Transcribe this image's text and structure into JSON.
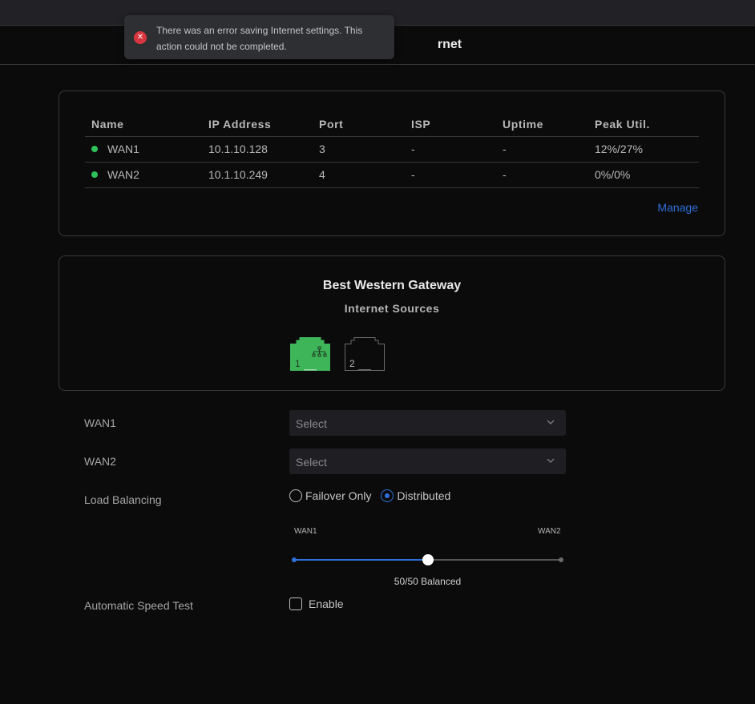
{
  "header": {
    "title_visible": "rnet"
  },
  "toast": {
    "icon": "error-x-icon",
    "message": "There was an error saving Internet settings. This action could not be completed."
  },
  "wan_table": {
    "columns": [
      "Name",
      "IP Address",
      "Port",
      "ISP",
      "Uptime",
      "Peak Util."
    ],
    "rows": [
      {
        "name": "WAN1",
        "status": "online",
        "ip": "10.1.10.128",
        "port": "3",
        "isp": "-",
        "uptime": "-",
        "peak_util": "12%/27%"
      },
      {
        "name": "WAN2",
        "status": "online",
        "ip": "10.1.10.249",
        "port": "4",
        "isp": "-",
        "uptime": "-",
        "peak_util": "0%/0%"
      }
    ],
    "manage_label": "Manage"
  },
  "gateway": {
    "title": "Best Western Gateway",
    "subtitle": "Internet Sources",
    "ports": [
      {
        "number": "1",
        "state": "connected",
        "icon": "network-topology-icon"
      },
      {
        "number": "2",
        "state": "disconnected"
      }
    ]
  },
  "form": {
    "wan1": {
      "label": "WAN1",
      "value": "Select"
    },
    "wan2": {
      "label": "WAN2",
      "value": "Select"
    },
    "load_balancing": {
      "label": "Load Balancing",
      "options": [
        {
          "label": "Failover Only",
          "selected": false
        },
        {
          "label": "Distributed",
          "selected": true
        }
      ]
    },
    "slider": {
      "left_label": "WAN1",
      "right_label": "WAN2",
      "value_percent": 50,
      "caption": "50/50 Balanced"
    },
    "speed_test": {
      "label": "Automatic Speed Test",
      "checkbox_label": "Enable",
      "checked": false
    }
  },
  "colors": {
    "accent": "#2f6fd8",
    "online": "#2fc25b",
    "error": "#d6363f",
    "port_active": "#3fb55a"
  }
}
